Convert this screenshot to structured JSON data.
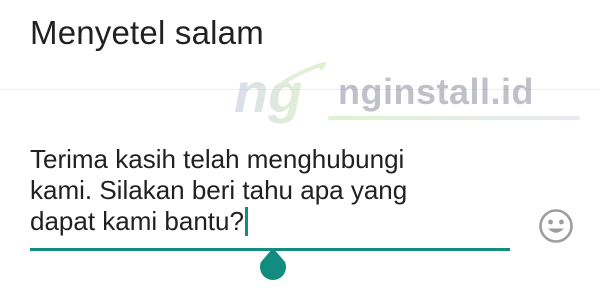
{
  "dialog": {
    "title": "Menyetel salam"
  },
  "message": {
    "value": "Terima kasih telah menghubungi\nkami. Silakan beri tahu apa yang\ndapat kami bantu?"
  },
  "watermark": {
    "logo_text": "ng",
    "site": "nginstall.id"
  },
  "icons": {
    "emoji": "smiley-face-icon",
    "handle": "text-selection-handle-icon"
  },
  "colors": {
    "accent": "#128c7e",
    "text": "#212121",
    "icon": "#9e9e9e"
  }
}
